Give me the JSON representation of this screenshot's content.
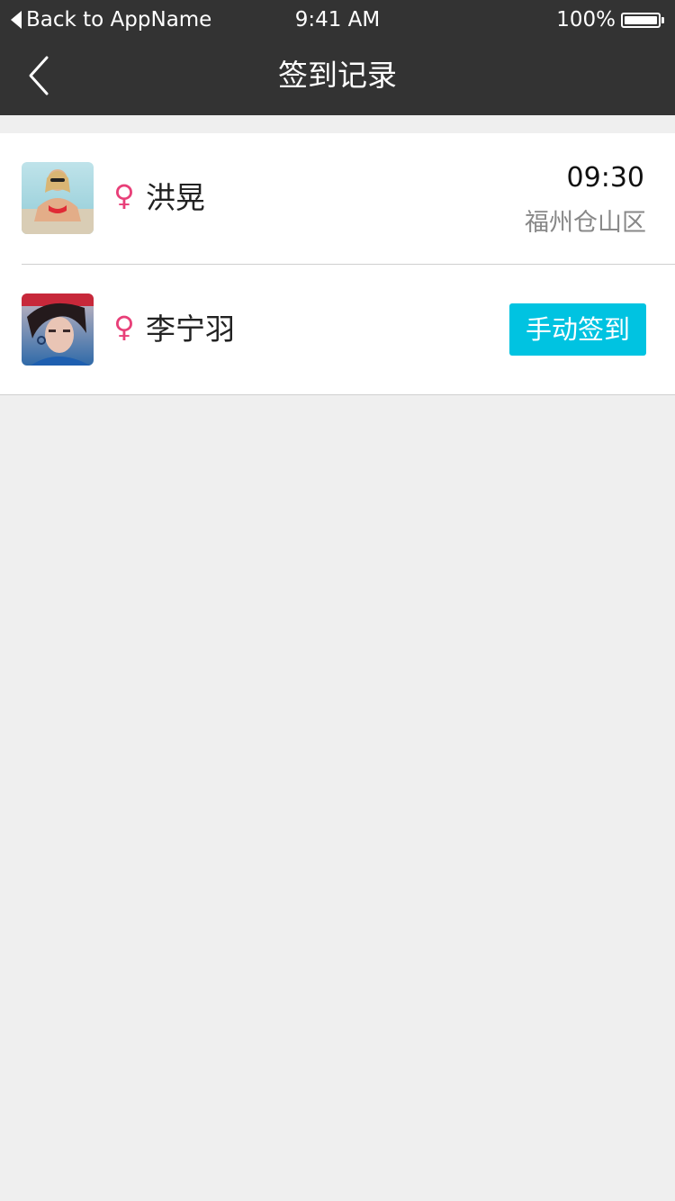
{
  "status_bar": {
    "back_app_label": "Back to AppName",
    "time": "9:41 AM",
    "battery": "100%"
  },
  "nav": {
    "title": "签到记录",
    "back_icon": "chevron-left-icon"
  },
  "colors": {
    "header_bg": "#333333",
    "page_bg": "#efefef",
    "accent": "#00c3e1",
    "gender_female": "#e83f78"
  },
  "records": [
    {
      "gender_symbol": "♀",
      "name": "洪晃",
      "time": "09:30",
      "location": "福州仓山区"
    },
    {
      "gender_symbol": "♀",
      "name": "李宁羽",
      "action_label": "手动签到"
    }
  ]
}
